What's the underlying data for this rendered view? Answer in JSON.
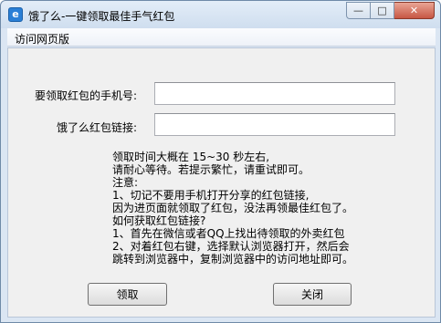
{
  "window": {
    "title": "饿了么-一键领取最佳手气红包",
    "icon_glyph": "e",
    "icon_name": "app-icon",
    "minimize_glyph": "—",
    "maximize_glyph": "□",
    "close_glyph": "✕",
    "accent": "#2a7fd6",
    "close_color": "#c75744"
  },
  "menu": {
    "items": [
      {
        "label": "访问网页版"
      }
    ]
  },
  "form": {
    "phone_label": "要领取红包的手机号:",
    "phone_value": "",
    "link_label": "饿了么红包链接:",
    "link_value": ""
  },
  "info": {
    "lines": [
      "领取时间大概在 15~30 秒左右,",
      "请耐心等待。若提示繁忙，请重试即可。",
      "注意:",
      "1、切记不要用手机打开分享的红包链接,",
      "因为进页面就领取了红包，没法再领最佳红包了。",
      "如何获取红包链接?",
      "1、首先在微信或者QQ上找出待领取的外卖红包",
      "2、对着红包右键，选择默认浏览器打开，然后会",
      "跳转到浏览器中，复制浏览器中的访问地址即可。"
    ]
  },
  "buttons": {
    "claim_label": "领取",
    "close_label": "关闭"
  }
}
